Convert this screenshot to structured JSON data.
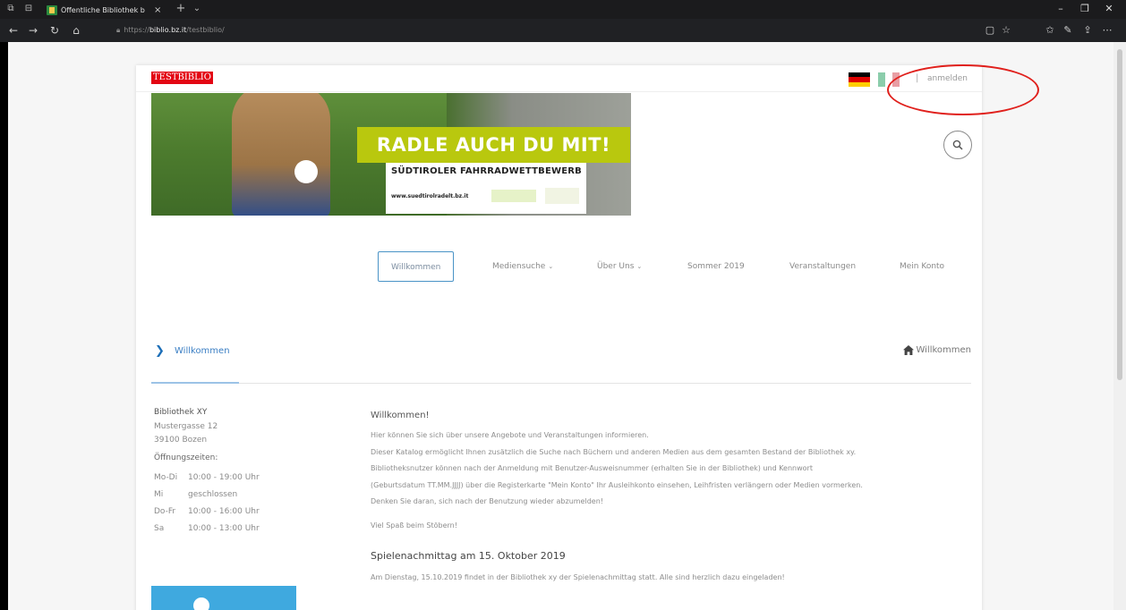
{
  "browser": {
    "tab_title": "Öffentliche Bibliothek b",
    "url_scheme": "https://",
    "url_host": "biblio.bz.it",
    "url_path": "/testbiblio/"
  },
  "site": {
    "logo_text": "TESTBIBLIO",
    "login_label": "anmelden",
    "separator": "|"
  },
  "banner": {
    "headline": "RADLE AUCH DU MIT!",
    "subline": "SÜDTIROLER FAHRRADWETTBEWERB",
    "website": "www.suedtirolradelt.bz.it"
  },
  "menu": {
    "items": [
      {
        "label": "Willkommen",
        "active": true
      },
      {
        "label": "Mediensuche",
        "has_dropdown": true
      },
      {
        "label": "Über Uns",
        "has_dropdown": true
      },
      {
        "label": "Sommer 2019"
      },
      {
        "label": "Veranstaltungen"
      },
      {
        "label": "Mein Konto"
      }
    ]
  },
  "breadcrumb": {
    "current": "Willkommen",
    "home_label": "Willkommen"
  },
  "sidebar": {
    "library_name": "Bibliothek XY",
    "street": "Mustergasse 12",
    "city": "39100 Bozen",
    "hours_title": "Öffnungszeiten:",
    "hours": [
      {
        "day": "Mo-Di",
        "time": "10:00 - 19:00 Uhr"
      },
      {
        "day": "Mi",
        "time": "geschlossen"
      },
      {
        "day": "Do-Fr",
        "time": "10:00 - 16:00 Uhr"
      },
      {
        "day": "Sa",
        "time": "10:00 - 13:00 Uhr"
      }
    ]
  },
  "content": {
    "welcome_title": "Willkommen!",
    "lines": [
      "Hier können Sie sich über unsere Angebote und Veranstaltungen informieren.",
      "Dieser Katalog ermöglicht Ihnen zusätzlich die Suche nach Büchern und anderen Medien aus dem gesamten Bestand der Bibliothek xy.",
      "Bibliotheksnutzer können nach der Anmeldung mit Benutzer-Ausweisnummer (erhalten Sie in der Bibliothek) und Kennwort",
      "(Geburtsdatum TT.MM.JJJJ) über die Registerkarte \"Mein Konto\" Ihr Ausleihkonto einsehen, Leihfristen verlängern oder Medien vormerken.",
      "Denken Sie daran, sich nach der Benutzung wieder abzumelden!"
    ],
    "closing": "Viel Spaß beim Stöbern!",
    "event_title": "Spielenachmittag am 15. Oktober 2019",
    "event_text": "Am Dienstag, 15.10.2019 findet in der Bibliothek xy der Spielenachmittag statt. Alle sind herzlich dazu eingeladen!"
  },
  "colors": {
    "accent": "#3b7fc4",
    "logo_bg": "#e30613",
    "banner_lime": "#b9c80e",
    "annotation": "#e0201c"
  }
}
